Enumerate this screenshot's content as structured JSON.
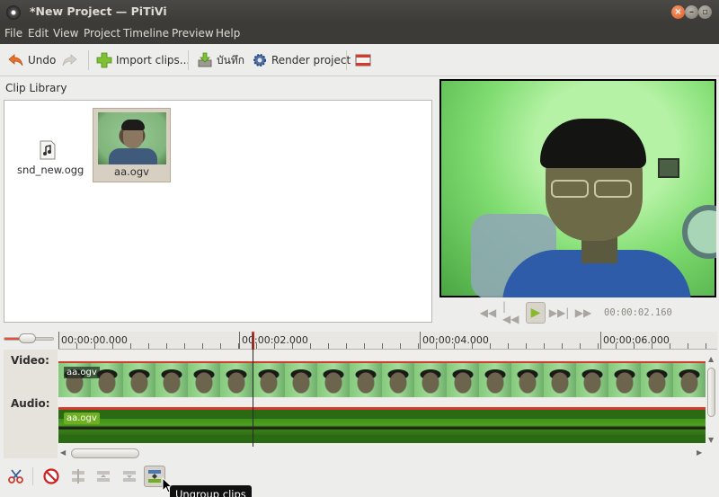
{
  "window": {
    "title": "*New Project — PiTiVi"
  },
  "menu": [
    "File",
    "Edit",
    "View",
    "Project",
    "Timeline",
    "Preview",
    "Help"
  ],
  "toolbar": {
    "undo_label": "Undo",
    "import_label": "Import clips...",
    "save_label": "บันทึก",
    "render_label": "Render project"
  },
  "clip_library": {
    "title": "Clip Library",
    "clips": [
      {
        "name": "snd_new.ogg",
        "kind": "audio"
      },
      {
        "name": "aa.ogv",
        "kind": "video",
        "selected": true
      }
    ]
  },
  "viewer": {
    "timecode": "00:00:02.160"
  },
  "timeline": {
    "ruler_labels": [
      "00:00:00.000",
      "00:00:02.000",
      "00:00:04.000",
      "00:00:06.000"
    ],
    "tracks": {
      "video_label": "Video:",
      "audio_label": "Audio:"
    },
    "video_clip_name": "aa.ogv",
    "audio_clip_name": "aa.ogv"
  },
  "tooltip": {
    "text": "Ungroup clips"
  },
  "colors": {
    "accent_red": "#d43a2e",
    "audio_green": "#6fb022",
    "menubar": "#3c3b37"
  }
}
